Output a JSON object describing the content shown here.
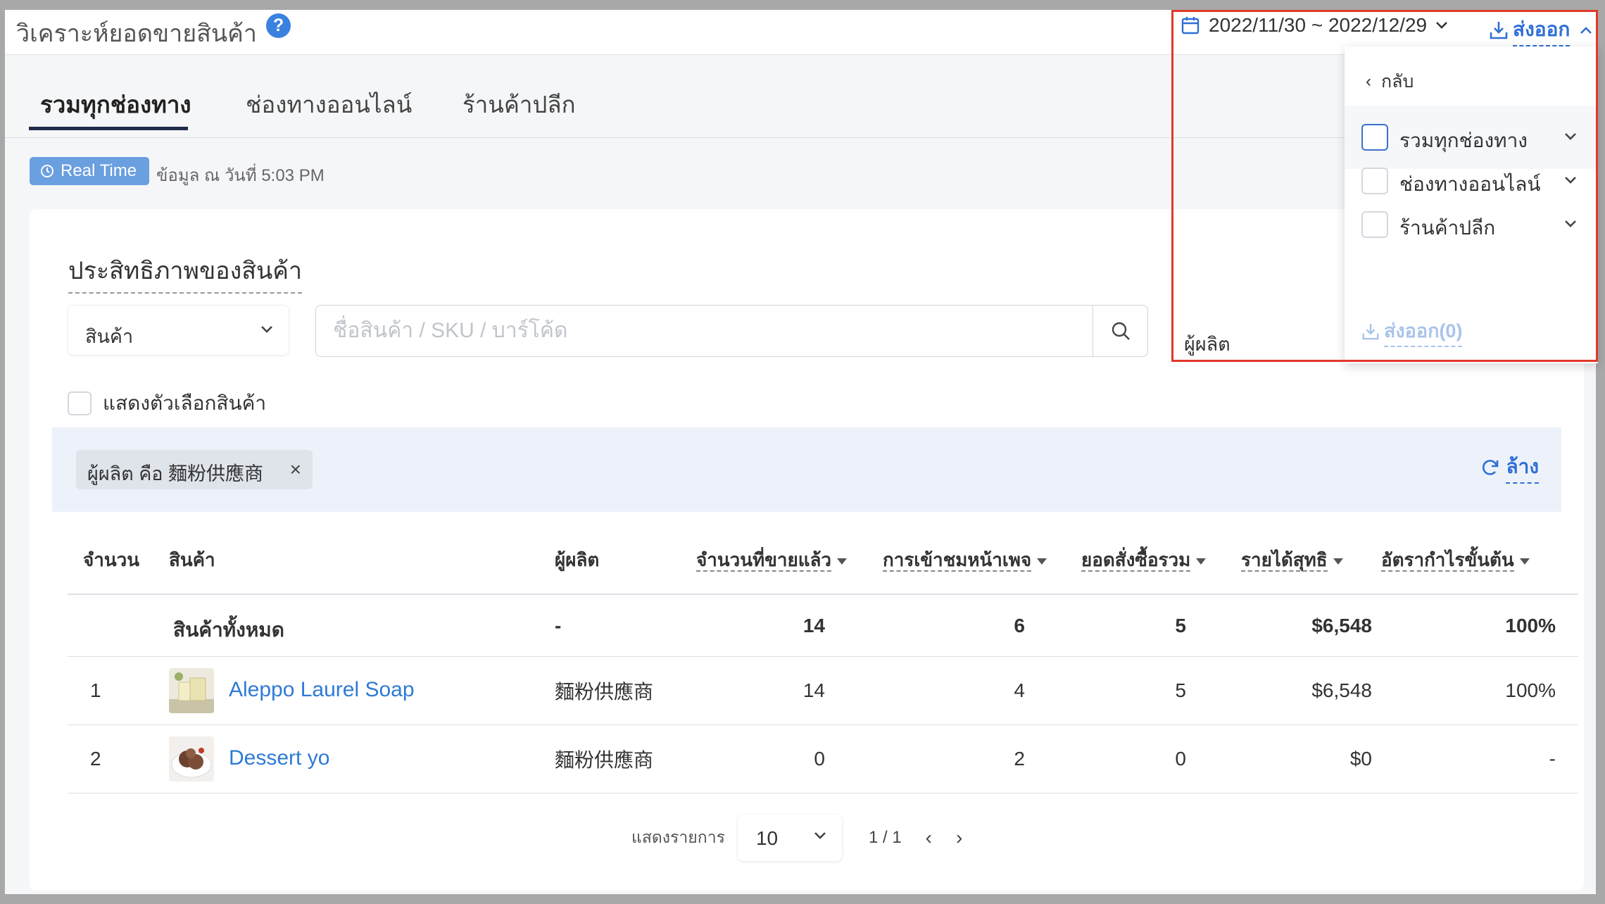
{
  "header": {
    "title": "วิเคราะห์ยอดขายสินค้า",
    "help_icon": "?",
    "date_range": "2022/11/30 ~ 2022/12/29",
    "export_label": "ส่งออก"
  },
  "tabs": [
    {
      "label": "รวมทุกช่องทาง",
      "active": true
    },
    {
      "label": "ช่องทางออนไลน์",
      "active": false
    },
    {
      "label": "ร้านค้าปลีก",
      "active": false
    }
  ],
  "realtime": {
    "badge": "Real Time",
    "data_time": "ข้อมูล ณ วันที่ 5:03 PM"
  },
  "section": {
    "title": "ประสิทธิภาพของสินค้า",
    "select_value": "สินค้า",
    "search_placeholder": "ชื่อสินค้า / SKU / บาร์โค้ด",
    "vendor_label": "ผู้ผลิต",
    "show_options_label": "แสดงตัวเลือกสินค้า"
  },
  "filter": {
    "chip": "ผู้ผลิต คือ 麵粉供應商",
    "chip_close": "×",
    "reset_label": "ล้าง"
  },
  "table": {
    "headers": {
      "no": "จำนวน",
      "product": "สินค้า",
      "vendor": "ผู้ผลิต",
      "sold": "จำนวนที่ขายแล้ว",
      "views": "การเข้าชมหน้าเพจ",
      "orders": "ยอดสั่งซื้อรวม",
      "revenue": "รายได้สุทธิ",
      "margin": "อัตรากำไรขั้นต้น"
    },
    "total": {
      "label": "สินค้าทั้งหมด",
      "vendor": "-",
      "sold": "14",
      "views": "6",
      "orders": "5",
      "revenue": "$6,548",
      "margin": "100%"
    },
    "rows": [
      {
        "no": "1",
        "product": "Aleppo Laurel Soap",
        "vendor": "麵粉供應商",
        "sold": "14",
        "views": "4",
        "orders": "5",
        "revenue": "$6,548",
        "margin": "100%"
      },
      {
        "no": "2",
        "product": "Dessert yo",
        "vendor": "麵粉供應商",
        "sold": "0",
        "views": "2",
        "orders": "0",
        "revenue": "$0",
        "margin": "-"
      }
    ]
  },
  "pagination": {
    "label": "แสดงรายการ",
    "page_size": "10",
    "page_info": "1 / 1",
    "prev": "‹",
    "next": "›"
  },
  "export_dropdown": {
    "back_label": "กลับ",
    "options": [
      {
        "label": "รวมทุกช่องทาง"
      },
      {
        "label": "ช่องทางออนไลน์"
      },
      {
        "label": "ร้านค้าปลีก"
      }
    ],
    "export_label": "ส่งออก(0)"
  },
  "colors": {
    "accent": "#2f6fd6",
    "highlight": "#e0392b",
    "badge": "#6a9fe0"
  }
}
